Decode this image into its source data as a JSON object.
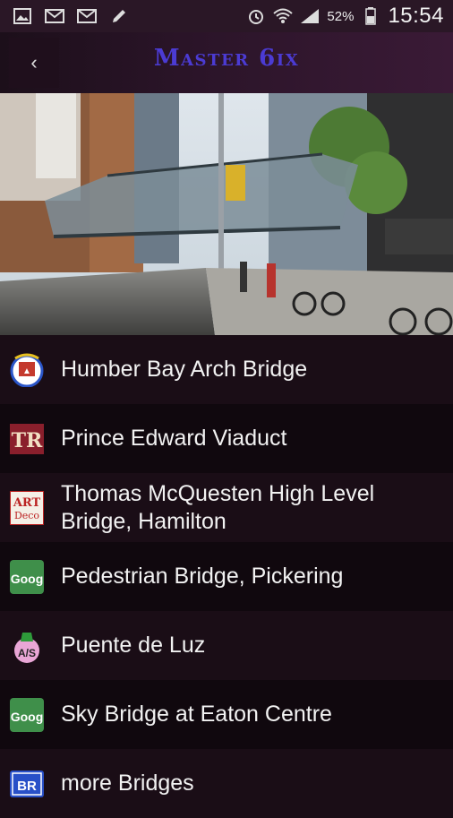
{
  "status_bar": {
    "left_icons": [
      "image-icon",
      "mail-icon",
      "mail-icon",
      "pencil-icon"
    ],
    "right_icons": [
      "alarm-icon",
      "wifi-icon",
      "signal-icon",
      "battery-icon"
    ],
    "battery": "52%",
    "time": "15:54"
  },
  "app_bar": {
    "back_icon": "chevron-left-icon",
    "title": "Master 6ix"
  },
  "hero": {
    "description_icon": "street-photo"
  },
  "items": [
    {
      "label": "Humber Bay Arch Bridge",
      "icon": "badge-icon"
    },
    {
      "label": "Prince Edward Viaduct",
      "icon": "tr-logo-icon"
    },
    {
      "label": "Thomas McQuesten High Level Bridge, Hamilton",
      "icon": "art-deco-icon"
    },
    {
      "label": "Pedestrian Bridge, Pickering",
      "icon": "goog-icon"
    },
    {
      "label": "Puente de Luz",
      "icon": "as-icon"
    },
    {
      "label": "Sky Bridge at Eaton Centre",
      "icon": "goog-icon"
    },
    {
      "label": "more Bridges",
      "icon": "br-icon"
    }
  ],
  "colors": {
    "title": "#4b3bd3",
    "background": "#1a0d16"
  }
}
